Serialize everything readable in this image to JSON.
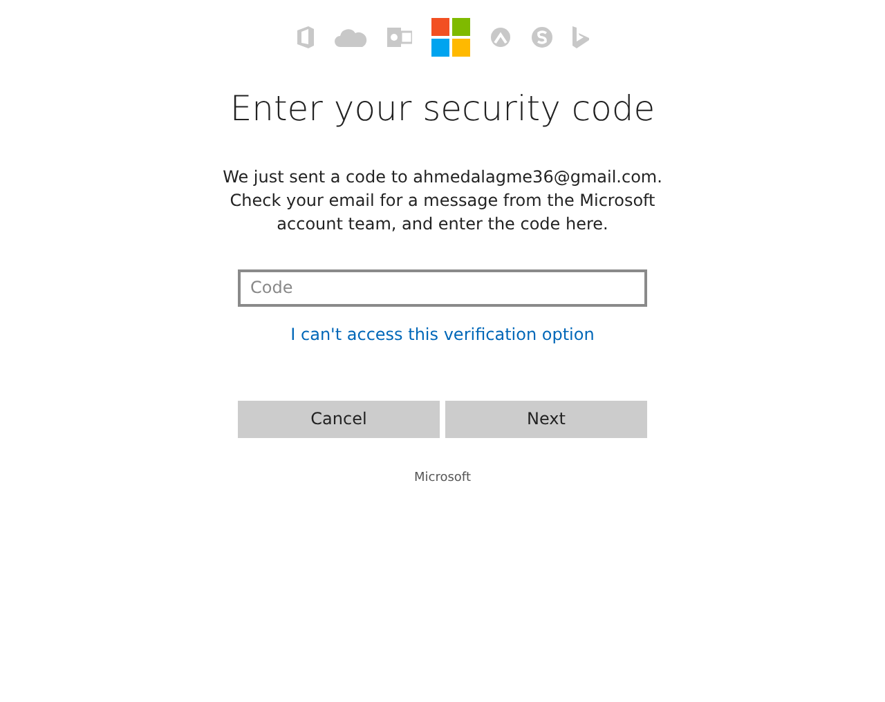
{
  "title": "Enter your security code",
  "message": "We just sent a code to ahmedalagme36@gmail.com. Check your email for a message from the Microsoft account team, and enter the code here.",
  "code_field": {
    "placeholder": "Code"
  },
  "link": "I can't access this verification option",
  "buttons": [
    "Cancel",
    "Next"
  ],
  "footer": "Microsoft"
}
